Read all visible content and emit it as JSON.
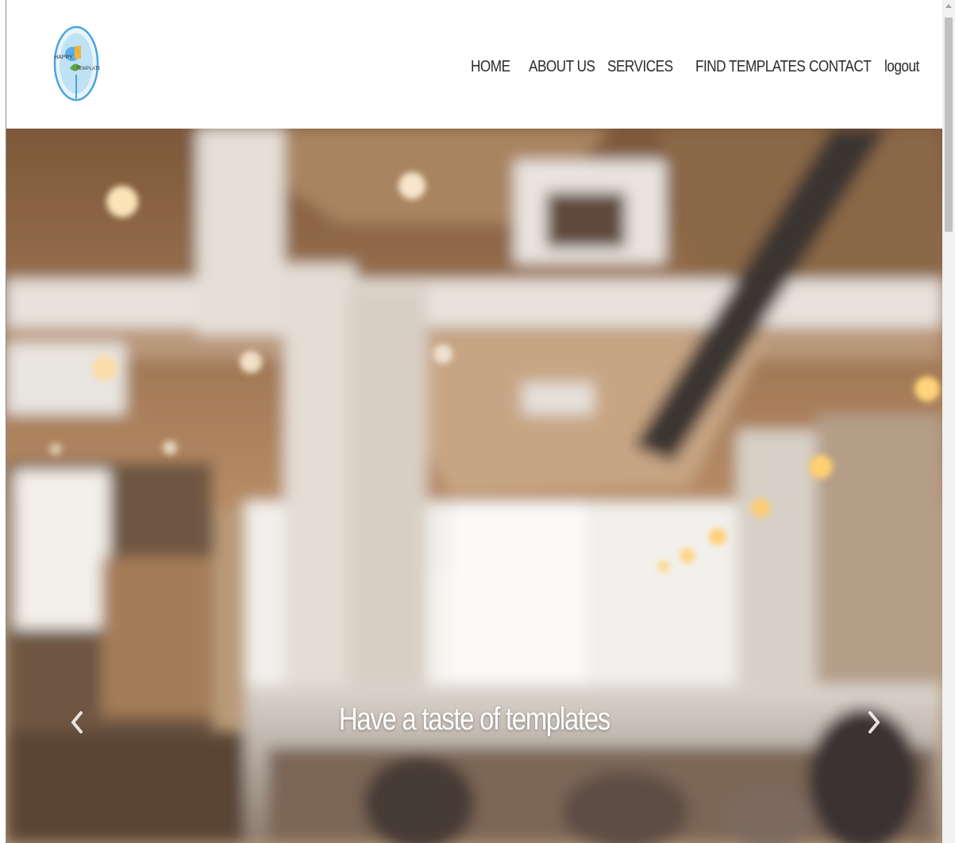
{
  "logo": {
    "alt_text": "HAPPY",
    "icon": "happy-logo-icon",
    "colors": {
      "ring": "#4aa3df",
      "accent": "#f0b43c",
      "green": "#5aa646"
    }
  },
  "nav": {
    "items": [
      {
        "label": "HOME"
      },
      {
        "label": "ABOUT US"
      },
      {
        "label": "SERVICES"
      },
      {
        "label": "FIND TEMPLATES"
      },
      {
        "label": "CONTACT"
      },
      {
        "label": "logout"
      }
    ],
    "text_color": "#2b2b2b"
  },
  "hero": {
    "caption": "Have a taste of templates",
    "prev_icon": "chevron-left-icon",
    "next_icon": "chevron-right-icon",
    "background_description_color": "#b89a78"
  },
  "scrollbar": {
    "up_icon": "scroll-up-arrow-icon"
  }
}
